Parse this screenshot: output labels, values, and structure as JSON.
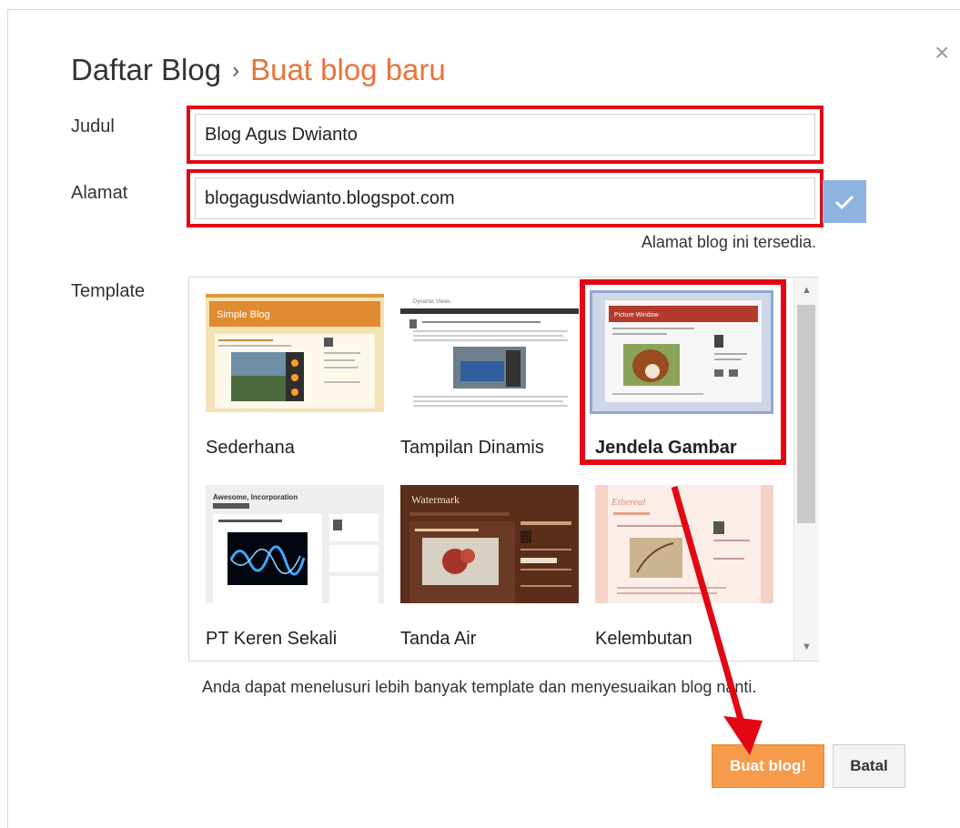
{
  "dialog": {
    "close_glyph": "×",
    "breadcrumb_parent": "Daftar Blog",
    "breadcrumb_separator": "›",
    "breadcrumb_current": "Buat blog baru"
  },
  "form": {
    "title_label": "Judul",
    "title_value": "Blog Agus Dwianto",
    "address_label": "Alamat",
    "address_value": "blogagusdwianto.blogspot.com",
    "address_status": "Alamat blog ini tersedia.",
    "template_label": "Template"
  },
  "templates": [
    {
      "name": "Sederhana",
      "selected": false,
      "preview_text": "Simple Blog"
    },
    {
      "name": "Tampilan Dinamis",
      "selected": false,
      "preview_text": "Dynamic Views"
    },
    {
      "name": "Jendela Gambar",
      "selected": true,
      "preview_text": "Picture Window"
    },
    {
      "name": "PT Keren Sekali",
      "selected": false,
      "preview_text": "Awesome, Incorporation"
    },
    {
      "name": "Tanda Air",
      "selected": false,
      "preview_text": "Watermark"
    },
    {
      "name": "Kelembutan",
      "selected": false,
      "preview_text": "Ethereal"
    }
  ],
  "hint": "Anda dapat menelusuri lebih banyak template dan menyesuaikan blog nanti.",
  "buttons": {
    "create": "Buat blog!",
    "cancel": "Batal"
  },
  "colors": {
    "accent_orange": "#e8733a",
    "highlight_red": "#e30613",
    "check_blue": "#8fb3e0",
    "create_button": "#f69a4b"
  },
  "icons": {
    "close": "close-icon",
    "check": "check-icon",
    "scroll_up": "scroll-up-icon",
    "scroll_down": "scroll-down-icon",
    "annotation_arrow": "red-arrow-annotation"
  }
}
